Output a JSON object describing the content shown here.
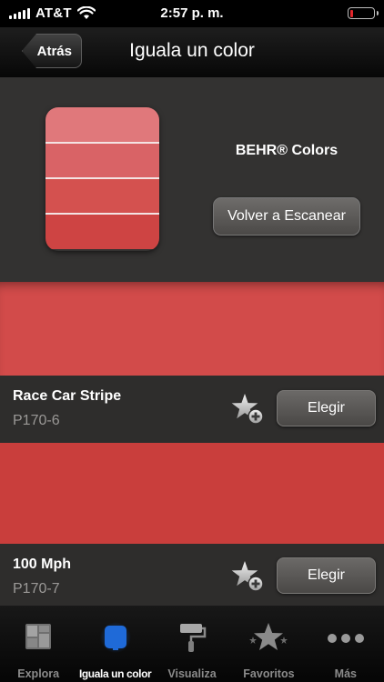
{
  "status_bar": {
    "carrier": "AT&T",
    "time": "2:57 p. m.",
    "battery_level": 0.12,
    "battery_color": "#e2262b"
  },
  "nav": {
    "back_label": "Atrás",
    "title": "Iguala un color"
  },
  "match": {
    "chip_colors": [
      "#e0787b",
      "#d96366",
      "#d4514f",
      "#ce4443"
    ],
    "brand": "BEHR® Colors",
    "rescan_label": "Volver a Escanear"
  },
  "results": [
    {
      "swatch_color": "#d24b4a",
      "name": "Race Car Stripe",
      "code": "P170-6",
      "favorite_icon": "star-add-icon",
      "choose_label": "Elegir"
    },
    {
      "swatch_color": "#c93e3c",
      "name": "100 Mph",
      "code": "P170-7",
      "favorite_icon": "star-add-icon",
      "choose_label": "Elegir"
    }
  ],
  "tabs": [
    {
      "id": "explora",
      "label": "Explora",
      "icon": "explore-grid-icon"
    },
    {
      "id": "iguala",
      "label": "Iguala un color",
      "icon": "color-match-chip-icon",
      "active": true
    },
    {
      "id": "visualiza",
      "label": "Visualiza",
      "icon": "paint-roller-icon"
    },
    {
      "id": "favoritos",
      "label": "Favoritos",
      "icon": "star-icon"
    },
    {
      "id": "mas",
      "label": "Más",
      "icon": "more-dots-icon"
    }
  ],
  "colors": {
    "tab_active_accent": "#1f6ad8",
    "tab_inactive": "#8b8b8b"
  }
}
